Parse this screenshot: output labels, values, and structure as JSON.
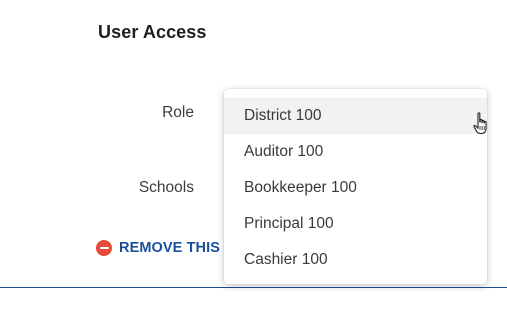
{
  "section": {
    "title": "User Access"
  },
  "fields": {
    "role_label": "Role",
    "schools_label": "Schools"
  },
  "remove": {
    "label": "REMOVE THIS I",
    "icon": "minus-circle-icon",
    "color": "#1c4f9a",
    "icon_color": "#e64a3b"
  },
  "role_dropdown": {
    "expanded": true,
    "hovered_option": "District 100",
    "options": [
      {
        "label": "District 100"
      },
      {
        "label": "Auditor 100"
      },
      {
        "label": "Bookkeeper 100"
      },
      {
        "label": "Principal 100"
      },
      {
        "label": "Cashier 100"
      }
    ]
  },
  "cursor": {
    "icon": "hand-pointer-icon"
  }
}
